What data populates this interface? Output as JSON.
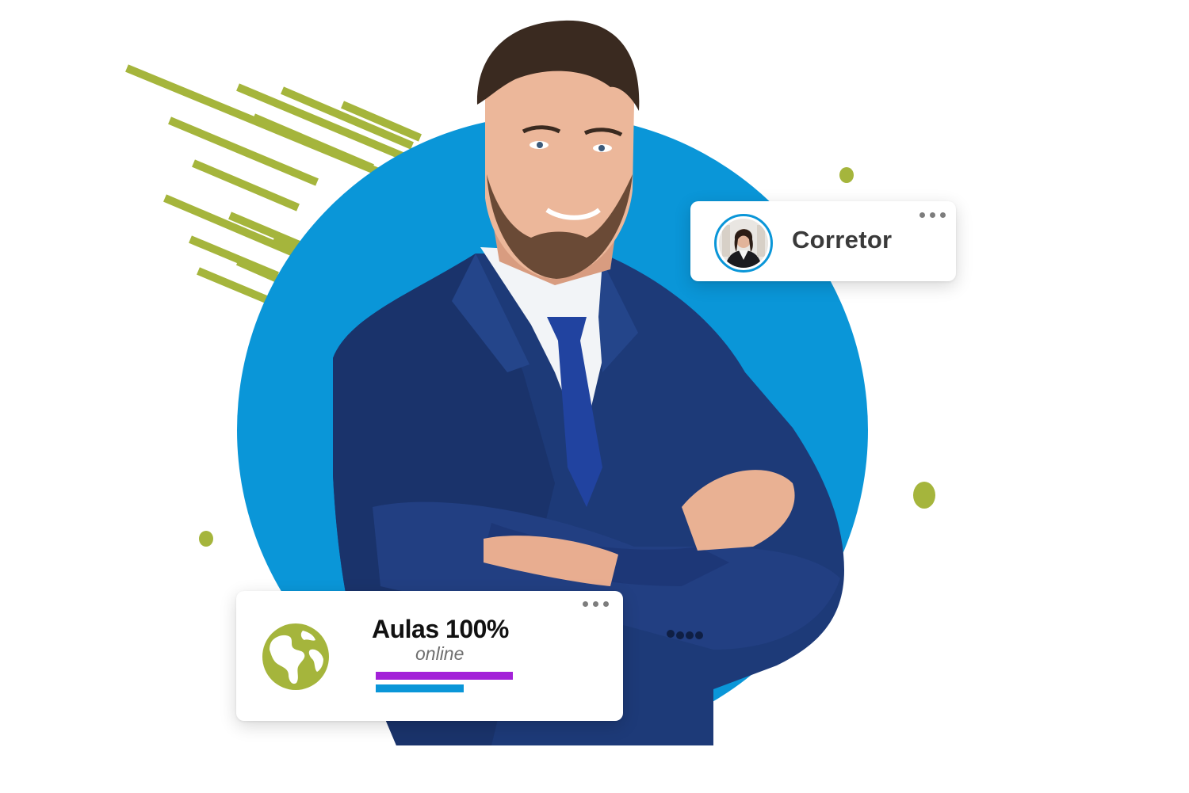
{
  "corretor_card": {
    "label": "Corretor",
    "avatar_icon": "person-avatar-icon",
    "menu_icon": "more-dots-icon"
  },
  "aulas_card": {
    "title": "Aulas 100%",
    "subtitle": "online",
    "icon": "globe-icon",
    "menu_icon": "more-dots-icon",
    "bars": [
      {
        "color": "#a321d8",
        "fill": 1.0
      },
      {
        "color": "#0a96d8",
        "fill": 0.64
      }
    ]
  },
  "hero": {
    "photo": "businessman-arms-crossed"
  },
  "colors": {
    "accent_blue": "#0a96d8",
    "accent_green": "#a5b53c",
    "text_dark": "#3a3a3a"
  }
}
